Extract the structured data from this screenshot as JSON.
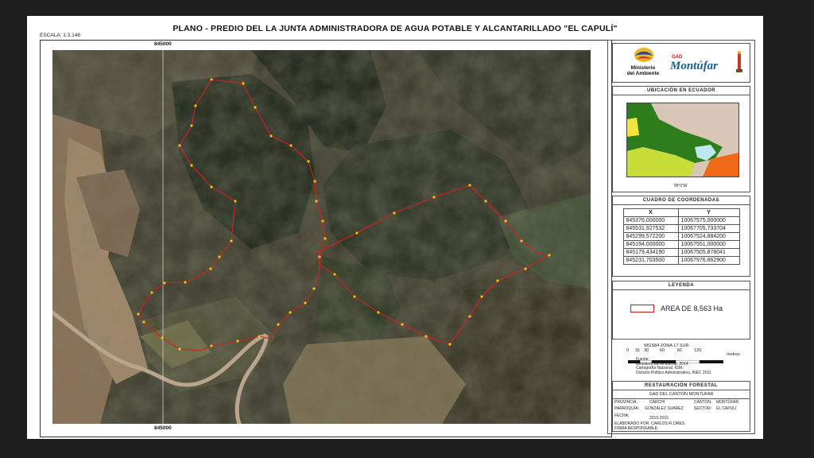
{
  "title": "PLANO - PREDIO DEL LA JUNTA ADMINISTRADORA DE AGUA POTABLE Y ALCANTARILLADO \"EL CAPULÍ\"",
  "escala": "ESCALA: 1:3.146",
  "grid_label_top": "845000",
  "grid_label_bottom": "845000",
  "logos": {
    "ministerio_line1": "Ministerio",
    "ministerio_line2": "del Ambiente",
    "gad_prefix": "GAD",
    "gad_name": "Montúfar"
  },
  "ubicacion": {
    "heading": "UBICACIÓN EN ECUADOR",
    "longitude_label": "78°0'W"
  },
  "coordenadas": {
    "heading": "CUADRO DE COORDENADAS",
    "headers": [
      "X",
      "Y"
    ],
    "rows": [
      [
        "845376,000000",
        "10067575,000000"
      ],
      [
        "845531,927532",
        "10067705,733704"
      ],
      [
        "845299,572200",
        "10067524,884200"
      ],
      [
        "845194,000000",
        "10067551,000000"
      ],
      [
        "845179,434190",
        "10067505,878041"
      ],
      [
        "845231,703500",
        "10067976,862900"
      ]
    ]
  },
  "leyenda": {
    "heading": "LEYENDA",
    "item": "AREA DE 8,563 Ha"
  },
  "scale": {
    "projection": "WGS84 ZONA 17 SUR",
    "ticks": [
      "0",
      "15",
      "30",
      "60",
      "90",
      "120"
    ],
    "unit": "metros",
    "fuente_label": "Fuente:",
    "fuente_lines": [
      "Ministerio del Ambiente, 2014.",
      "Cartografía Nacional, IGM.",
      "División Político Administrativo, INEC 2011"
    ]
  },
  "footer": {
    "heading": "RESTAURACIÓN FORESTAL",
    "gad": "GAD DEL CANTÓN MONTÚFAR",
    "provincia_label": "PROVINCIA:",
    "provincia": "CARCHI",
    "canton_label": "CANTON:",
    "canton": "MONTÚFAR",
    "parroquia_label": "PARROQUIA:",
    "parroquia": "GONZÁLEZ SUÁREZ",
    "sector_label": "SECTOR:",
    "sector": "EL CAPULÍ",
    "fecha_label": "FECHA:",
    "fecha": "2015-2016",
    "elaborado": "ELABORADO POR: CARLOS FLORES",
    "firma": "FIRMA RESPONSABLE:"
  },
  "colors": {
    "boundary": "#d42020",
    "vertex": "#f2c21b",
    "vegetation_dark": "#1f2b19",
    "dry_field": "#9c8061"
  }
}
